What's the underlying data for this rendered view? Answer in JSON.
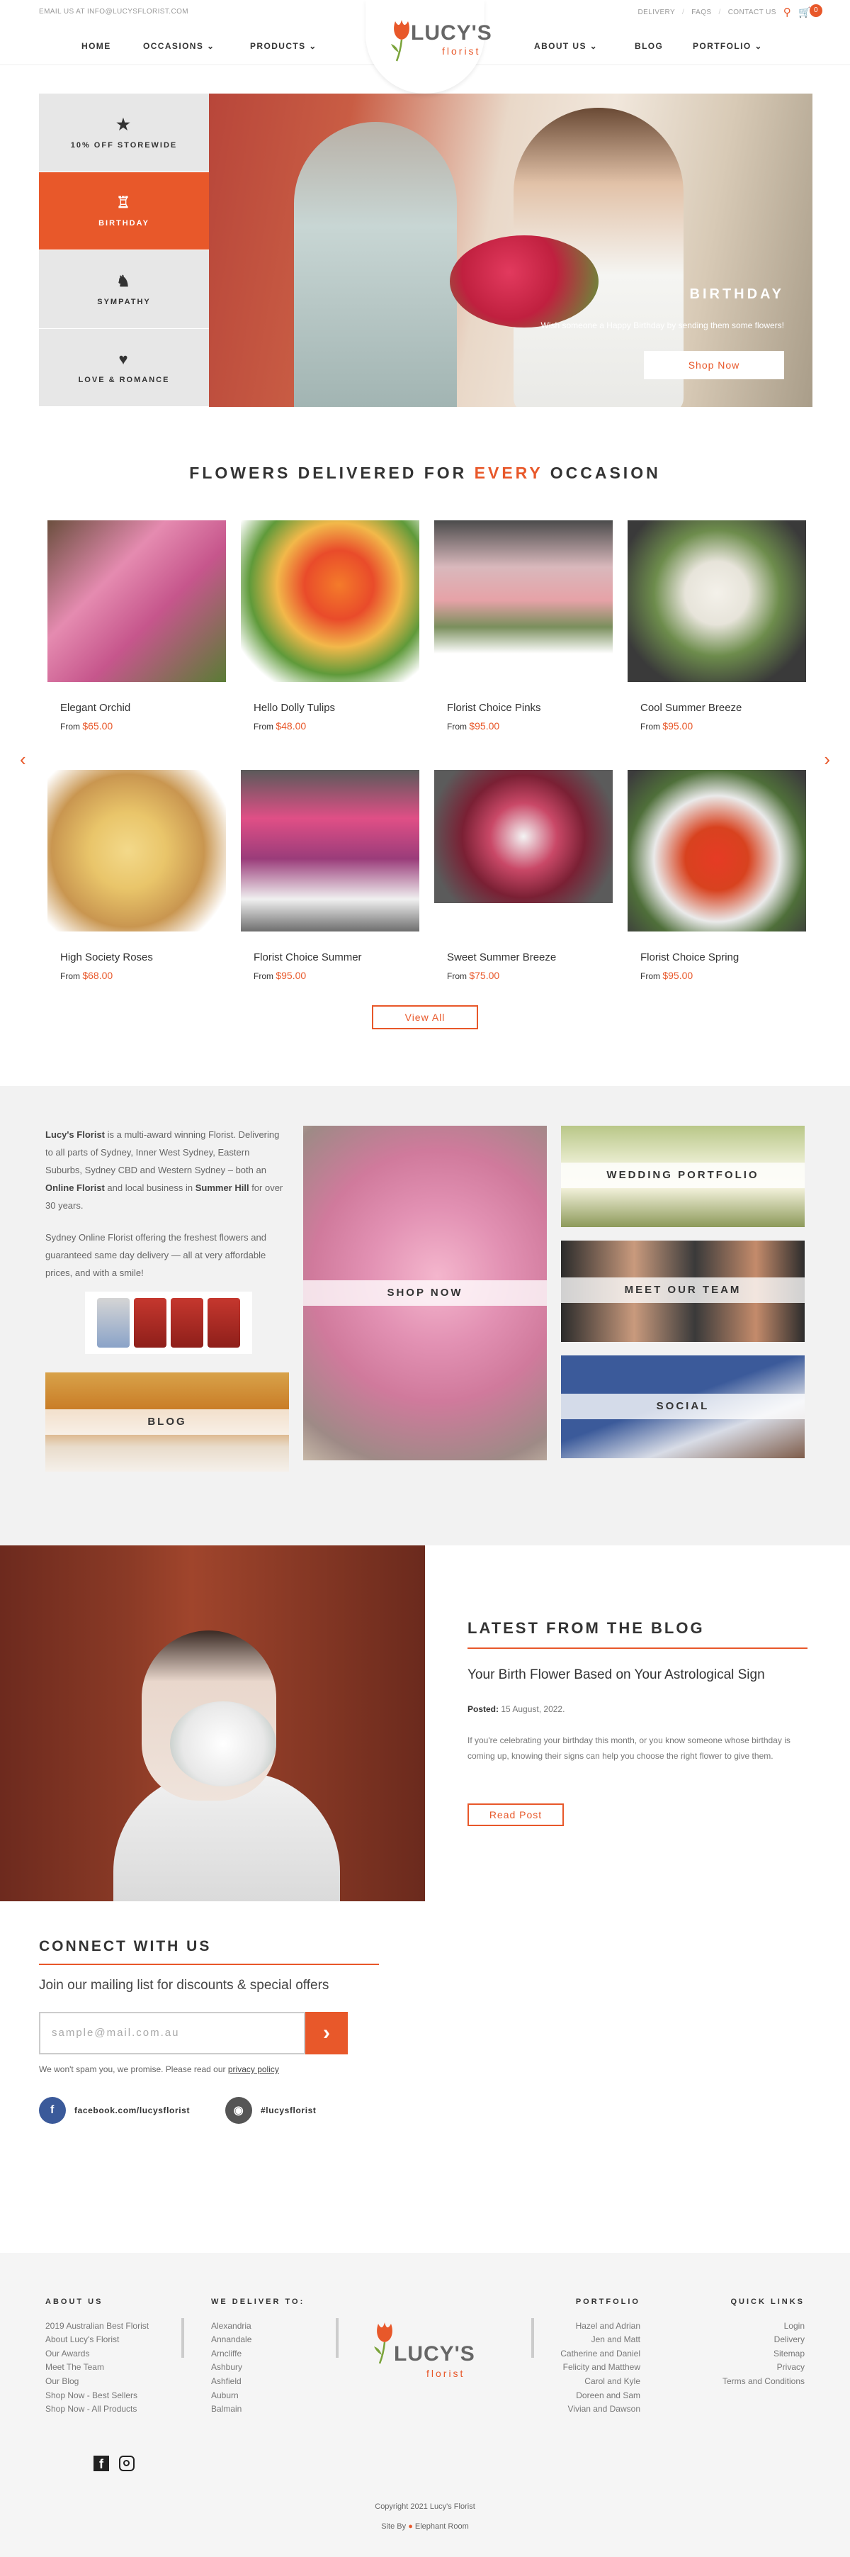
{
  "topbar": {
    "email": "EMAIL US AT INFO@LUCYSFLORIST.COM",
    "links": [
      "DELIVERY",
      "FAQS",
      "CONTACT US"
    ],
    "cart_count": "0"
  },
  "logo": {
    "name": "LUCY'S",
    "sub": "florist"
  },
  "nav": {
    "home": "HOME",
    "occasions": "OCCASIONS",
    "products": "PRODUCTS",
    "about": "ABOUT US",
    "blog": "BLOG",
    "portfolio": "PORTFOLIO"
  },
  "hero": {
    "occasions": [
      {
        "label": "10% OFF STOREWIDE",
        "icon": "★"
      },
      {
        "label": "BIRTHDAY",
        "icon": "♖"
      },
      {
        "label": "SYMPATHY",
        "icon": "♞"
      },
      {
        "label": "LOVE & ROMANCE",
        "icon": "♥"
      }
    ],
    "title": "BIRTHDAY",
    "subtitle": "Wish someone a Happy Birthday by sending them some flowers!",
    "button": "Shop Now"
  },
  "occasion_section": {
    "title_pre": "FLOWERS DELIVERED FOR ",
    "title_hl": "EVERY",
    "title_post": " OCCASION",
    "from": "From",
    "view_all": "View All",
    "products": [
      {
        "name": "Elegant Orchid",
        "price": "$65.00"
      },
      {
        "name": "Hello Dolly Tulips",
        "price": "$48.00"
      },
      {
        "name": "Florist Choice Pinks",
        "price": "$95.00"
      },
      {
        "name": "Cool Summer Breeze",
        "price": "$95.00"
      },
      {
        "name": "High Society Roses",
        "price": "$68.00"
      },
      {
        "name": "Florist Choice Summer",
        "price": "$95.00"
      },
      {
        "name": "Sweet Summer Breeze",
        "price": "$75.00"
      },
      {
        "name": "Florist Choice Spring",
        "price": "$95.00"
      }
    ]
  },
  "features": {
    "p1_a": "Lucy's Florist",
    "p1_b": " is a multi-award winning Florist. Delivering to all parts of Sydney, Inner West Sydney, Eastern Suburbs, Sydney CBD and Western Sydney – both an ",
    "p1_c": "Online Florist",
    "p1_d": " and local business in ",
    "p1_e": "Summer Hill",
    "p1_f": " for over 30 years.",
    "p2": "Sydney Online Florist offering the freshest flowers and guaranteed same day delivery — all at very affordable prices, and with a smile!",
    "tiles": {
      "blog": "BLOG",
      "shop": "SHOP NOW",
      "wedding": "WEDDING PORTFOLIO",
      "team": "MEET OUR TEAM",
      "social": "SOCIAL"
    }
  },
  "blog": {
    "heading": "LATEST FROM THE BLOG",
    "title": "Your Birth Flower Based on Your Astrological Sign",
    "posted_label": "Posted:",
    "posted_date": " 15 August, 2022.",
    "excerpt": "If you're celebrating your birthday this month, or you know someone whose birthday is coming up, knowing their signs can help you choose the right flower to give them.",
    "button": "Read Post"
  },
  "connect": {
    "heading": "CONNECT WITH US",
    "subheading": "Join our mailing list for discounts & special offers",
    "placeholder": "sample@mail.com.au",
    "note": "We won't spam you, we promise. Please read our ",
    "privacy": "privacy policy",
    "facebook": "facebook.com/lucysflorist",
    "instagram": "#lucysflorist"
  },
  "footer": {
    "about": {
      "heading": "ABOUT US",
      "items": [
        "2019 Australian Best Florist",
        "About Lucy's Florist",
        "Our Awards",
        "Meet The Team",
        "Our Blog",
        "Shop Now - Best Sellers",
        "Shop Now - All Products"
      ]
    },
    "deliver": {
      "heading": "WE DELIVER TO:",
      "items": [
        "Alexandria",
        "Annandale",
        "Arncliffe",
        "Ashbury",
        "Ashfield",
        "Auburn",
        "Balmain"
      ]
    },
    "portfolio": {
      "heading": "PORTFOLIO",
      "items": [
        "Hazel and Adrian",
        "Jen and Matt",
        "Catherine and Daniel",
        "Felicity and Matthew",
        "Carol and Kyle",
        "Doreen and Sam",
        "Vivian and Dawson"
      ]
    },
    "quick": {
      "heading": "QUICK LINKS",
      "items": [
        "Login",
        "Delivery",
        "Sitemap",
        "Privacy",
        "Terms and Conditions"
      ]
    },
    "copyright": "Copyright 2021 Lucy's Florist",
    "site_by": "Site By",
    "agency": "Elephant Room"
  },
  "colors": {
    "accent": "#e8582a",
    "light_bg": "#f2f2f2"
  }
}
